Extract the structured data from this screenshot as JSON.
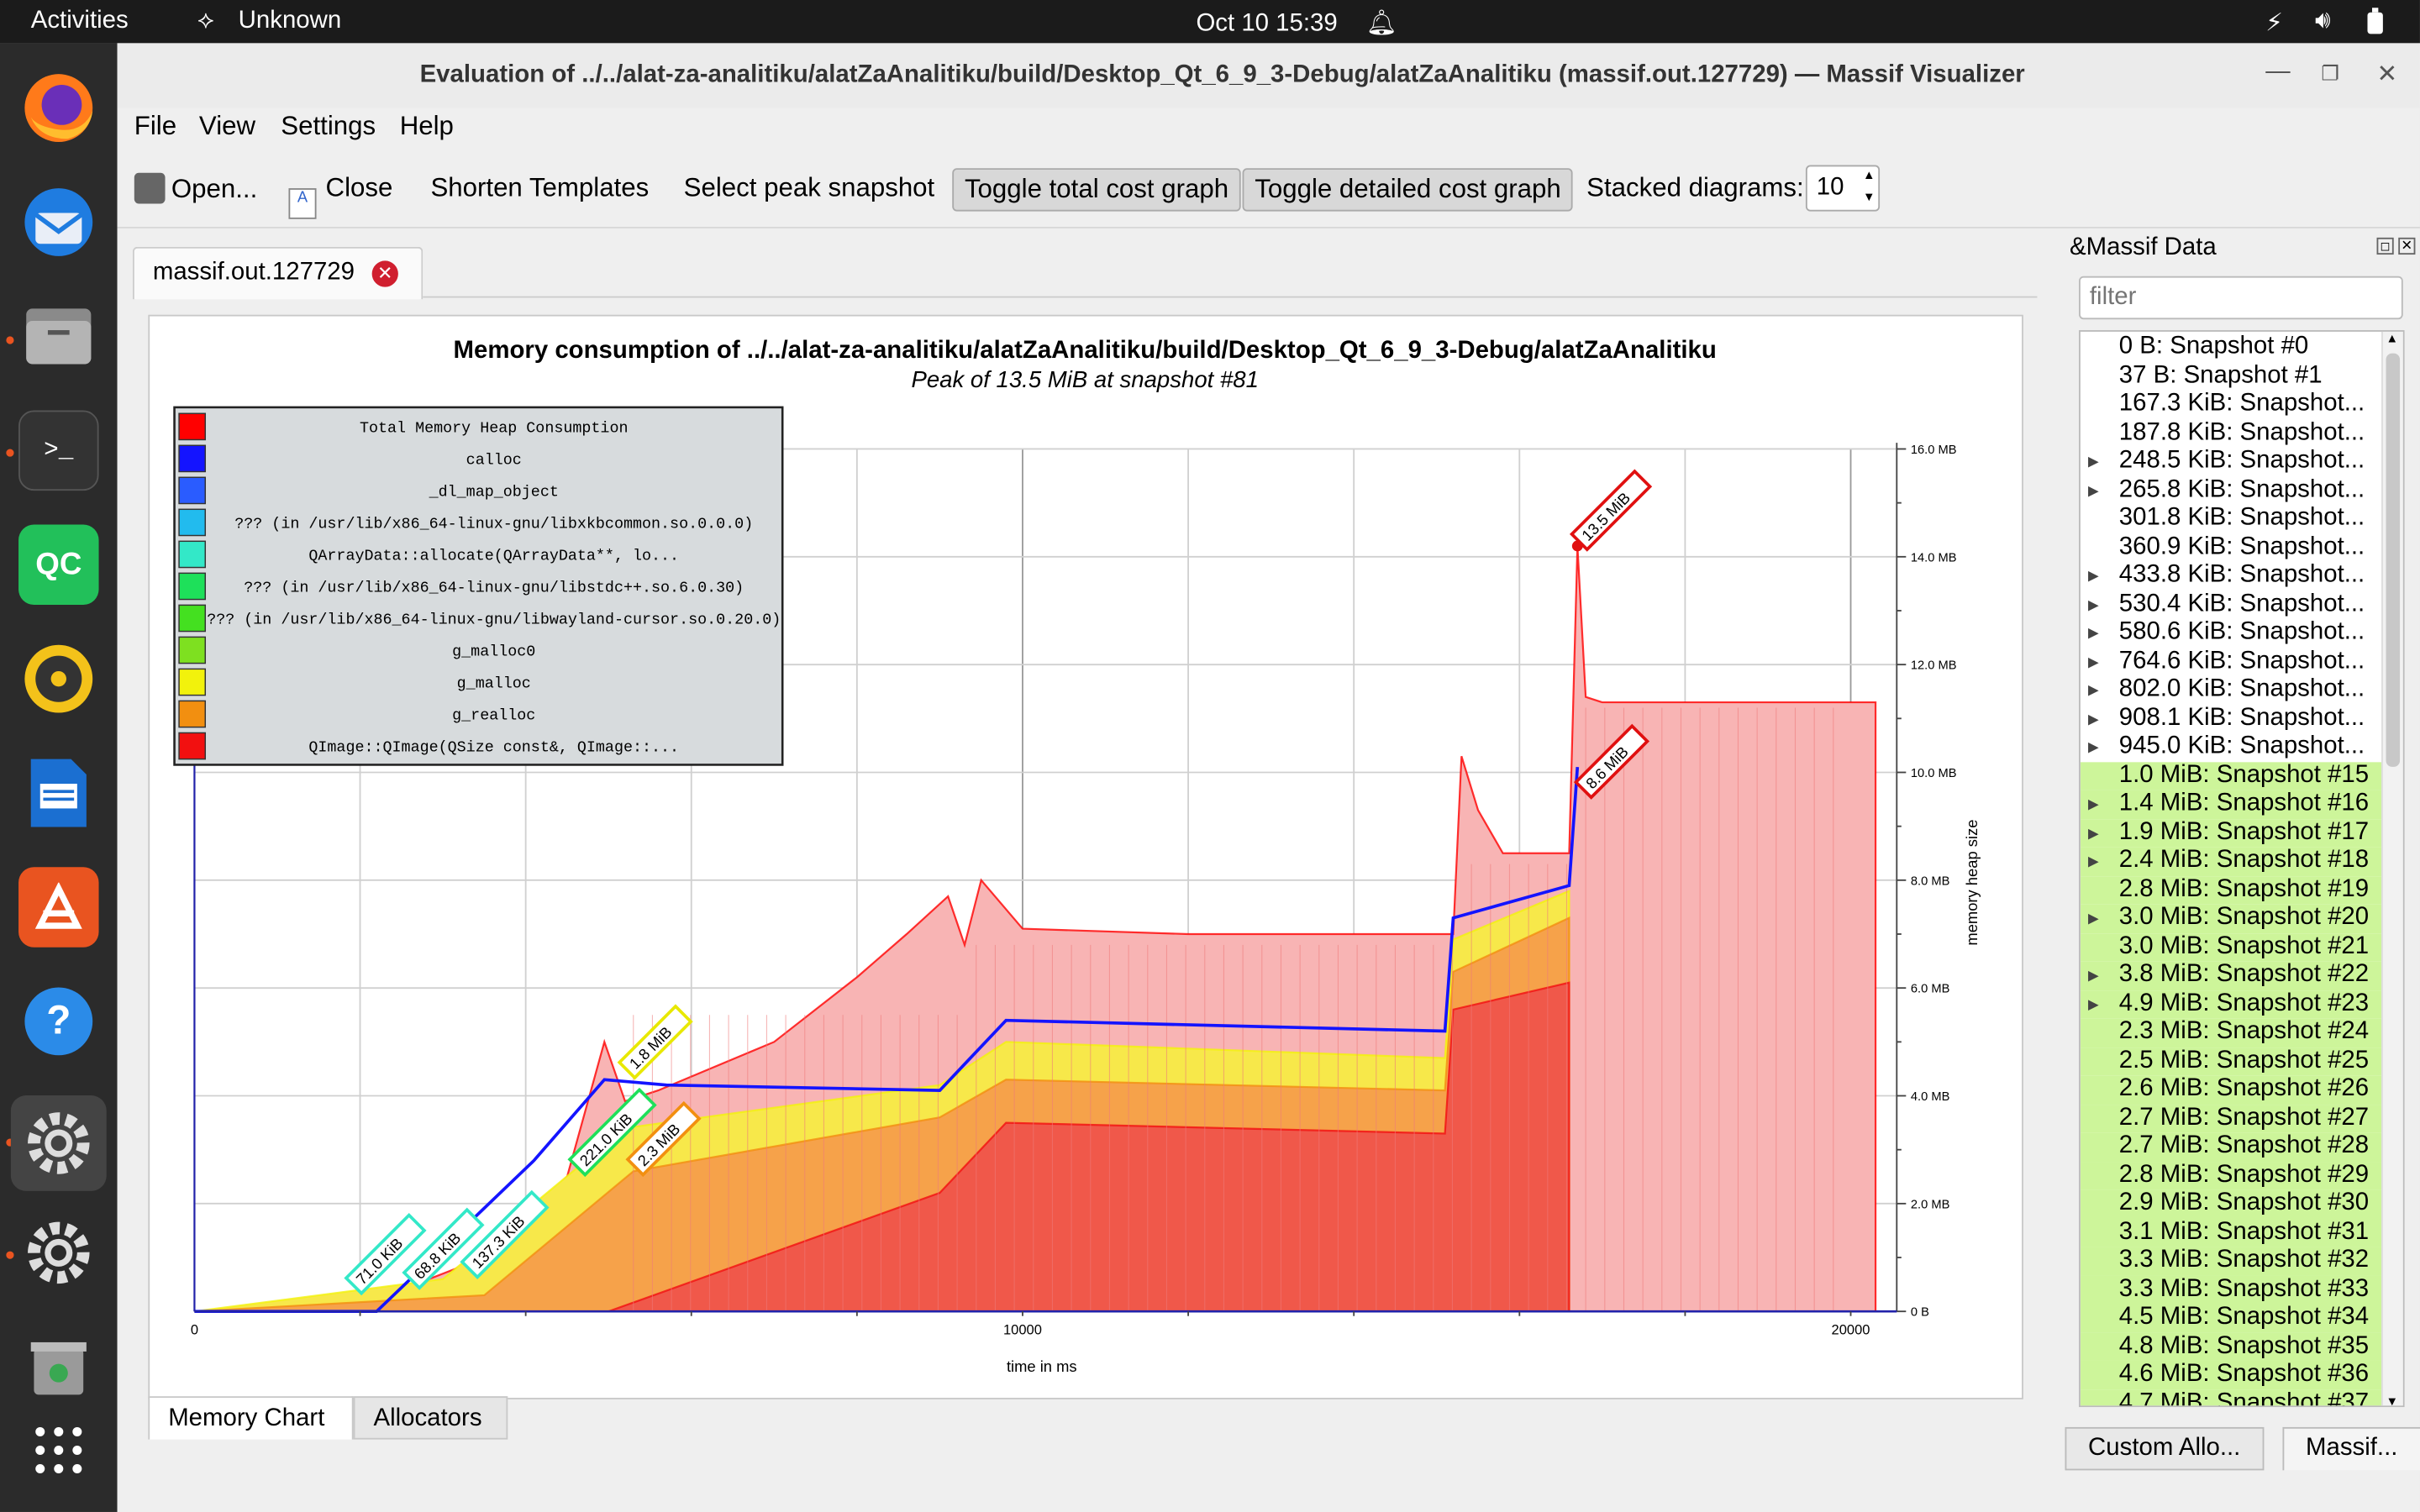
{
  "topbar": {
    "activities": "Activities",
    "app": "Unknown",
    "clock": "Oct 10  15:39"
  },
  "dock": {
    "items": [
      "firefox-icon",
      "thunderbird-icon",
      "files-icon",
      "terminal-icon",
      "qtcreator-icon",
      "rhythmbox-icon",
      "writer-icon",
      "appcenter-icon",
      "help-icon",
      "settings-icon",
      "settings2-icon",
      "trash-icon",
      "apps-grid-icon"
    ],
    "qc_label": "QC"
  },
  "window": {
    "title": "Evaluation of ../../alat-za-analitiku/alatZaAnalitiku/build/Desktop_Qt_6_9_3-Debug/alatZaAnalitiku (massif.out.127729) — Massif Visualizer"
  },
  "menu": {
    "file": "File",
    "view": "View",
    "settings": "Settings",
    "help": "Help"
  },
  "toolbar": {
    "open": "Open...",
    "close": "Close",
    "shorten": "Shorten Templates",
    "select_peak": "Select peak snapshot",
    "toggle_total": "Toggle total cost graph",
    "toggle_detailed": "Toggle detailed cost graph",
    "stacked_label": "Stacked diagrams:",
    "stacked_value": "10"
  },
  "tab": {
    "label": "massif.out.127729"
  },
  "chart_data": {
    "type": "area",
    "title": "Memory consumption of ../../alat-za-analitiku/alatZaAnalitiku/build/Desktop_Qt_6_9_3-Debug/alatZaAnalitiku",
    "subtitle": "Peak of 13.5 MiB at snapshot #81",
    "xlabel": "time in ms",
    "ylabel": "memory heap size",
    "x_ticks": [
      "0",
      "10000",
      "20000"
    ],
    "y_ticks": [
      "0 B",
      "2.0 MB",
      "4.0 MB",
      "6.0 MB",
      "8.0 MB",
      "10.0 MB",
      "12.0 MB",
      "14.0 MB",
      "16.0 MB"
    ],
    "xlim": [
      0,
      20500
    ],
    "ylim": [
      0,
      16
    ],
    "legend_position": "top-left",
    "legend": [
      {
        "name": "Total Memory Heap Consumption",
        "color": "#ff0000"
      },
      {
        "name": "calloc",
        "color": "#1414ff"
      },
      {
        "name": "_dl_map_object",
        "color": "#2a5cff"
      },
      {
        "name": "??? (in /usr/lib/x86_64-linux-gnu/libxkbcommon.so.0.0.0)",
        "color": "#22bbee"
      },
      {
        "name": "QArrayData::allocate(QArrayData**, lo...",
        "color": "#33e8c8"
      },
      {
        "name": "??? (in /usr/lib/x86_64-linux-gnu/libstdc++.so.6.0.30)",
        "color": "#1ee05a"
      },
      {
        "name": "??? (in /usr/lib/x86_64-linux-gnu/libwayland-cursor.so.0.20.0)",
        "color": "#44e020"
      },
      {
        "name": "g_malloc0",
        "color": "#7ee020"
      },
      {
        "name": "g_malloc",
        "color": "#f2f20c"
      },
      {
        "name": "g_realloc",
        "color": "#f28f10"
      },
      {
        "name": "QImage::QImage(QSize const&, QImage::...",
        "color": "#f21010"
      }
    ],
    "series": [
      {
        "name": "Total Memory Heap Consumption",
        "x": [
          0,
          1100,
          1700,
          2500,
          3500,
          4500,
          4950,
          5200,
          5600,
          7000,
          8000,
          8600,
          9100,
          9300,
          9500,
          10000,
          12000,
          15200,
          15300,
          15500,
          15800,
          16300,
          16600,
          16700,
          16800,
          17000,
          20000
        ],
        "y": [
          0,
          0.1,
          0.3,
          0.4,
          1.0,
          2.5,
          5.0,
          3.9,
          4.1,
          5.0,
          6.2,
          7.0,
          7.7,
          6.8,
          8.0,
          7.1,
          7.0,
          7.0,
          10.3,
          9.3,
          8.5,
          8.5,
          8.5,
          14.2,
          11.4,
          11.3,
          11.3
        ]
      },
      {
        "name": "calloc",
        "x": [
          0,
          2200,
          4100,
          4950,
          5700,
          9000,
          9800,
          15100,
          15200,
          16600,
          16700
        ],
        "y": [
          0,
          0,
          2.8,
          4.3,
          4.2,
          4.1,
          5.4,
          5.2,
          7.3,
          7.9,
          10.1
        ]
      },
      {
        "name": "g_malloc",
        "x": [
          0,
          3000,
          5200,
          9000,
          9800,
          15100,
          15200,
          16600
        ],
        "y": [
          0,
          0.6,
          3.4,
          4.2,
          5.0,
          4.7,
          6.9,
          7.8
        ]
      },
      {
        "name": "g_realloc",
        "x": [
          0,
          3500,
          5300,
          9000,
          9800,
          15100,
          15200,
          16600
        ],
        "y": [
          0,
          0.3,
          2.6,
          3.6,
          4.3,
          4.1,
          6.3,
          7.3
        ]
      },
      {
        "name": "QImage::QImage(QSize const&, QImage::...",
        "x": [
          0,
          5000,
          9000,
          9800,
          15100,
          15200,
          16600
        ],
        "y": [
          0,
          0,
          2.2,
          3.5,
          3.3,
          5.6,
          6.1
        ]
      }
    ],
    "annotations": [
      {
        "text": "13.5 MiB",
        "x": 16700,
        "y": 14.2,
        "color": "#e01010"
      },
      {
        "text": "8.6 MiB",
        "x": 16750,
        "y": 9.6,
        "color": "#e01010"
      },
      {
        "text": "1.8 MiB",
        "x": 5200,
        "y": 4.4,
        "color": "#e8e800"
      },
      {
        "text": "2.3 MiB",
        "x": 5300,
        "y": 2.6,
        "color": "#f28f10"
      },
      {
        "text": "221.0 KiB",
        "x": 4600,
        "y": 2.6,
        "color": "#1ee05a"
      },
      {
        "text": "137.3 KiB",
        "x": 3300,
        "y": 0.7,
        "color": "#33e8c8"
      },
      {
        "text": "68.8 KiB",
        "x": 2600,
        "y": 0.5,
        "color": "#33e8c8"
      },
      {
        "text": "71.0 KiB",
        "x": 1900,
        "y": 0.4,
        "color": "#33e8c8"
      }
    ]
  },
  "bottom_tabs": {
    "memory_chart": "Memory Chart",
    "allocators": "Allocators"
  },
  "panel": {
    "title": "&Massif Data",
    "filter_placeholder": "filter",
    "rows": [
      {
        "label": "0 B: Snapshot #0",
        "arrow": false,
        "highlight": false
      },
      {
        "label": "37 B: Snapshot #1",
        "arrow": false,
        "highlight": false
      },
      {
        "label": "167.3 KiB: Snapshot...",
        "arrow": false,
        "highlight": false
      },
      {
        "label": "187.8 KiB: Snapshot...",
        "arrow": false,
        "highlight": false
      },
      {
        "label": "248.5 KiB: Snapshot...",
        "arrow": true,
        "highlight": false
      },
      {
        "label": "265.8 KiB: Snapshot...",
        "arrow": true,
        "highlight": false
      },
      {
        "label": "301.8 KiB: Snapshot...",
        "arrow": false,
        "highlight": false
      },
      {
        "label": "360.9 KiB: Snapshot...",
        "arrow": false,
        "highlight": false
      },
      {
        "label": "433.8 KiB: Snapshot...",
        "arrow": true,
        "highlight": false
      },
      {
        "label": "530.4 KiB: Snapshot...",
        "arrow": true,
        "highlight": false
      },
      {
        "label": "580.6 KiB: Snapshot...",
        "arrow": true,
        "highlight": false
      },
      {
        "label": "764.6 KiB: Snapshot...",
        "arrow": true,
        "highlight": false
      },
      {
        "label": "802.0 KiB: Snapshot...",
        "arrow": true,
        "highlight": false
      },
      {
        "label": "908.1 KiB: Snapshot...",
        "arrow": true,
        "highlight": false
      },
      {
        "label": "945.0 KiB: Snapshot...",
        "arrow": true,
        "highlight": false
      },
      {
        "label": "1.0 MiB: Snapshot #15",
        "arrow": false,
        "highlight": true
      },
      {
        "label": "1.4 MiB: Snapshot #16",
        "arrow": true,
        "highlight": true
      },
      {
        "label": "1.9 MiB: Snapshot #17",
        "arrow": true,
        "highlight": true
      },
      {
        "label": "2.4 MiB: Snapshot #18",
        "arrow": true,
        "highlight": true
      },
      {
        "label": "2.8 MiB: Snapshot #19",
        "arrow": false,
        "highlight": true
      },
      {
        "label": "3.0 MiB: Snapshot #20",
        "arrow": true,
        "highlight": true
      },
      {
        "label": "3.0 MiB: Snapshot #21",
        "arrow": false,
        "highlight": true
      },
      {
        "label": "3.8 MiB: Snapshot #22",
        "arrow": true,
        "highlight": true
      },
      {
        "label": "4.9 MiB: Snapshot #23",
        "arrow": true,
        "highlight": true
      },
      {
        "label": "2.3 MiB: Snapshot #24",
        "arrow": false,
        "highlight": true
      },
      {
        "label": "2.5 MiB: Snapshot #25",
        "arrow": false,
        "highlight": true
      },
      {
        "label": "2.6 MiB: Snapshot #26",
        "arrow": false,
        "highlight": true
      },
      {
        "label": "2.7 MiB: Snapshot #27",
        "arrow": false,
        "highlight": true
      },
      {
        "label": "2.7 MiB: Snapshot #28",
        "arrow": false,
        "highlight": true
      },
      {
        "label": "2.8 MiB: Snapshot #29",
        "arrow": false,
        "highlight": true
      },
      {
        "label": "2.9 MiB: Snapshot #30",
        "arrow": false,
        "highlight": true
      },
      {
        "label": "3.1 MiB: Snapshot #31",
        "arrow": false,
        "highlight": true
      },
      {
        "label": "3.3 MiB: Snapshot #32",
        "arrow": false,
        "highlight": true
      },
      {
        "label": "3.3 MiB: Snapshot #33",
        "arrow": false,
        "highlight": true
      },
      {
        "label": "4.5 MiB: Snapshot #34",
        "arrow": false,
        "highlight": true
      },
      {
        "label": "4.8 MiB: Snapshot #35",
        "arrow": false,
        "highlight": true
      },
      {
        "label": "4.6 MiB: Snapshot #36",
        "arrow": false,
        "highlight": true
      },
      {
        "label": "4.7 MiB: Snapshot #37",
        "arrow": false,
        "highlight": true
      }
    ],
    "custom_alloc": "Custom Allo...",
    "massif_btn": "Massif..."
  }
}
